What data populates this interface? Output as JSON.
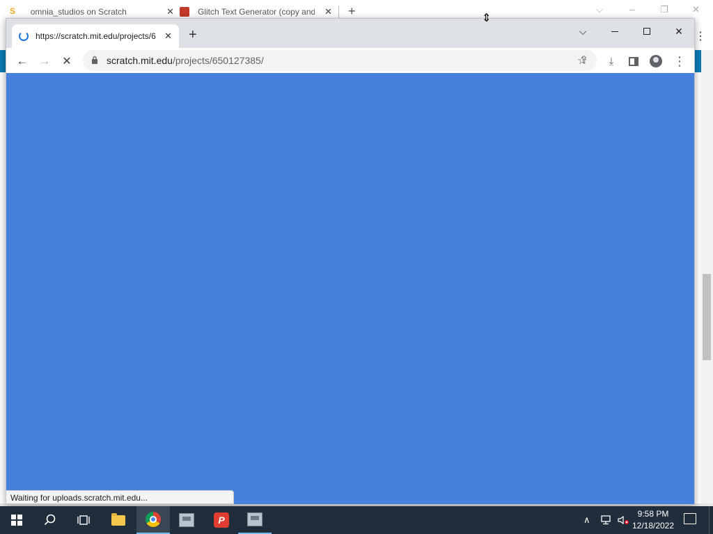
{
  "background_window": {
    "tabs": [
      {
        "title": "omnia_studios on Scratch",
        "favicon": "scratch-favicon"
      },
      {
        "title": "Glitch Text Generator (copy and p",
        "favicon": "glitch-favicon"
      }
    ],
    "new_tab": "+",
    "controls": {
      "chevron": "⌵",
      "minimize": "–",
      "restore": "❐",
      "close": "✕"
    }
  },
  "browser": {
    "tab": {
      "title": "https://scratch.mit.edu/projects/6",
      "close": "✕"
    },
    "new_tab": "+",
    "window_controls": {
      "chevron": "⌵",
      "close": "✕"
    },
    "address": {
      "host": "scratch.mit.edu",
      "path": "/projects/650127385/"
    },
    "status_text": "Waiting for uploads.scratch.mit.edu...",
    "content_bg": "#4480dc"
  },
  "icons": {
    "back": "←",
    "forward": "→",
    "reload": "✕",
    "lock": "🔒",
    "share": "⇪",
    "star": "☆",
    "download": "⤓",
    "menu": "⋮"
  },
  "taskbar": {
    "apps": [
      "start",
      "search",
      "task-view",
      "file-explorer",
      "chrome",
      "app",
      "psiphon",
      "app"
    ],
    "psiphon_letter": "P",
    "tray": {
      "chevron": "∧",
      "network": "🖧",
      "volume": "🔈"
    },
    "time": "9:58 PM",
    "date": "12/18/2022"
  }
}
